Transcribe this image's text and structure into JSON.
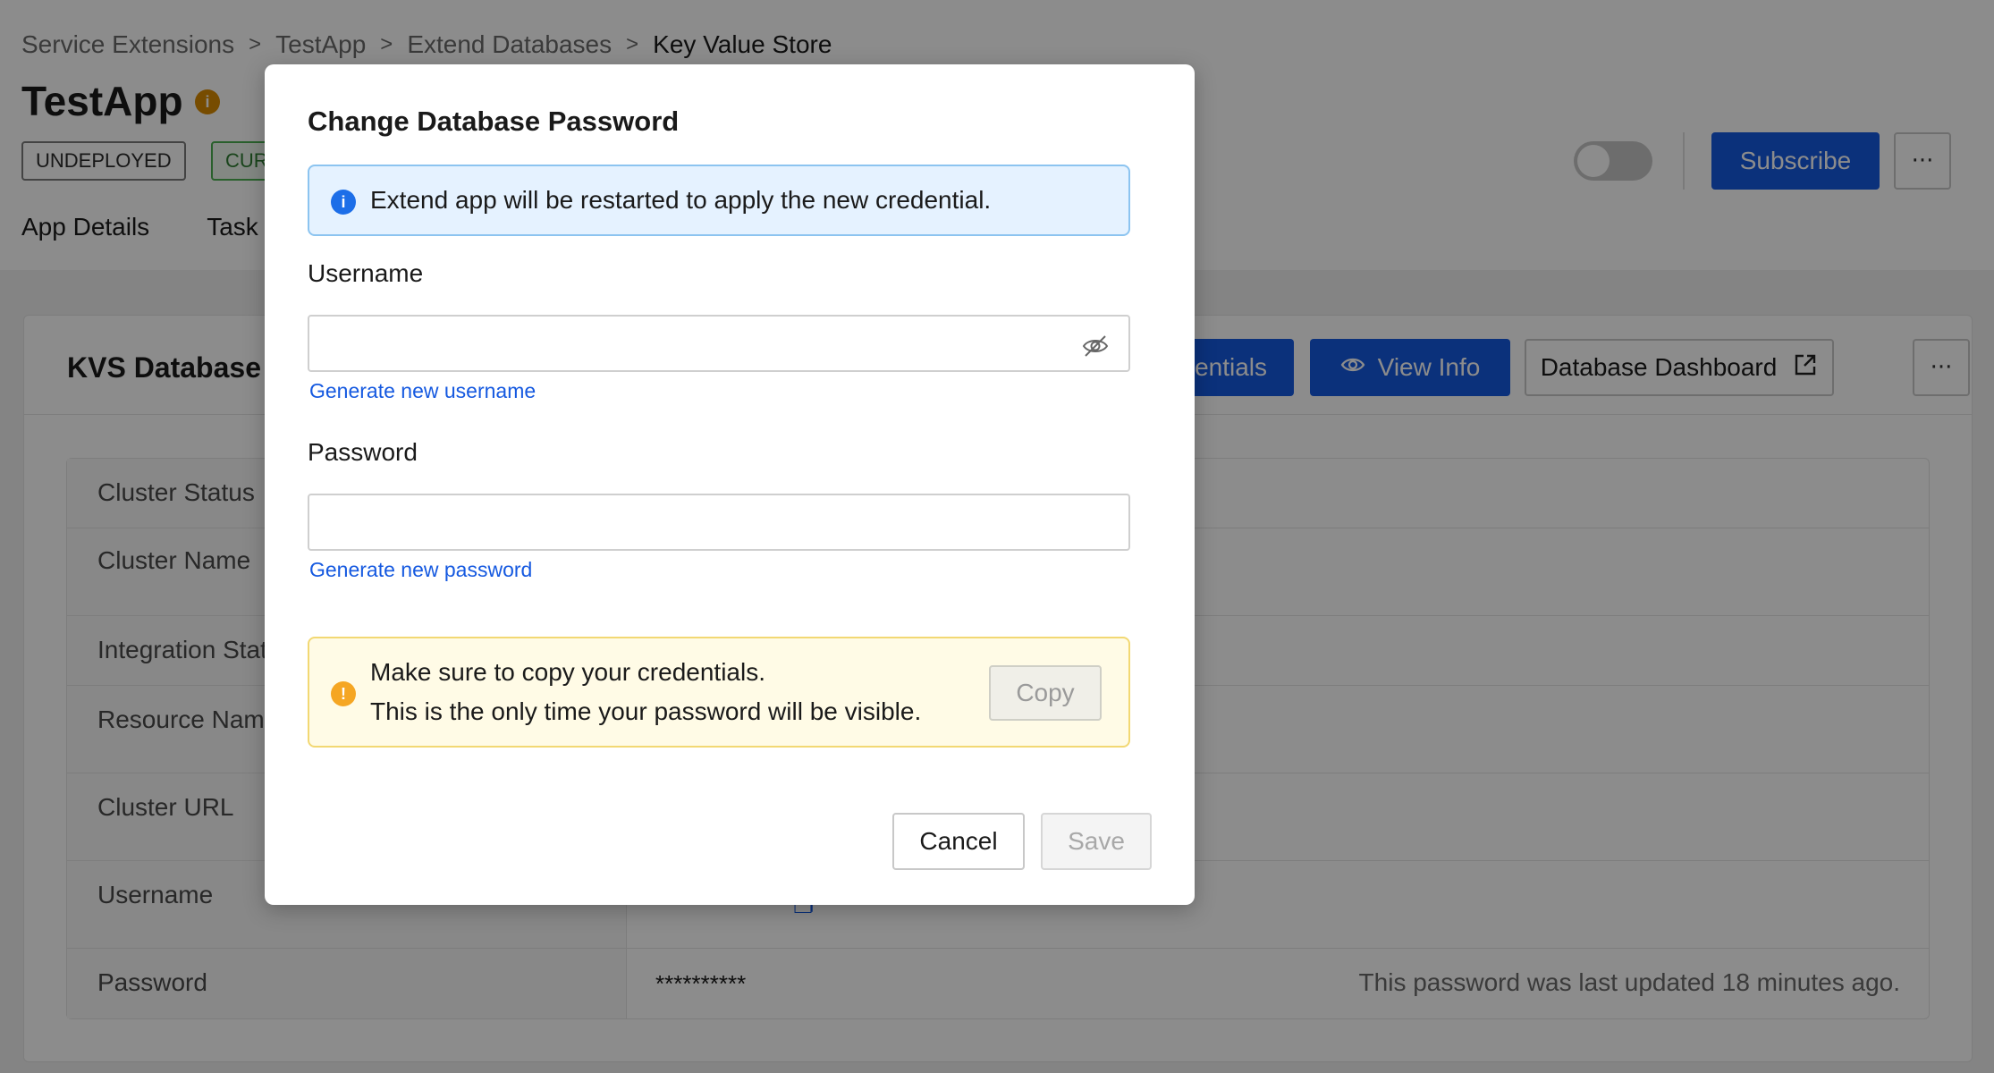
{
  "breadcrumb": {
    "items": [
      "Service Extensions",
      "TestApp",
      "Extend Databases"
    ],
    "separator": ">",
    "current": "Key Value Store"
  },
  "app": {
    "title": "TestApp",
    "info_icon": "info-icon",
    "status_badge": "UNDEPLOYED",
    "current_badge": "CUR"
  },
  "tabs": [
    "App Details",
    "Task"
  ],
  "header_actions": {
    "toggle_state": "off",
    "subscribe_label": "Subscribe",
    "more_label": "···"
  },
  "card": {
    "title": "KVS Database",
    "credentials_label": "entials",
    "view_info_label": "View Info",
    "dashboard_label": "Database Dashboard",
    "more_label": "···"
  },
  "table": {
    "rows": [
      {
        "label": "Cluster Status"
      },
      {
        "label": "Cluster Name"
      },
      {
        "label": "Integration Stat"
      },
      {
        "label": "Resource Name"
      },
      {
        "label": "Cluster URL"
      },
      {
        "label": "Username"
      },
      {
        "label": "Password",
        "value": "**********",
        "note": "This password was last updated 18 minutes ago."
      }
    ]
  },
  "modal": {
    "title": "Change Database Password",
    "info_text": "Extend app will be restarted to apply the new credential.",
    "username_label": "Username",
    "username_value": "",
    "generate_username": "Generate new username",
    "password_label": "Password",
    "password_value": "",
    "generate_password": "Generate new password",
    "warning_line1": "Make sure to copy your credentials.",
    "warning_line2": "This is the only time your password will be visible.",
    "copy_label": "Copy",
    "cancel_label": "Cancel",
    "save_label": "Save"
  },
  "colors": {
    "primary": "#1559e0",
    "info_bg": "#e5f2ff",
    "warning_bg": "#fffbe6",
    "warning_icon": "#f5a623",
    "title_info_icon": "#d98a00"
  }
}
